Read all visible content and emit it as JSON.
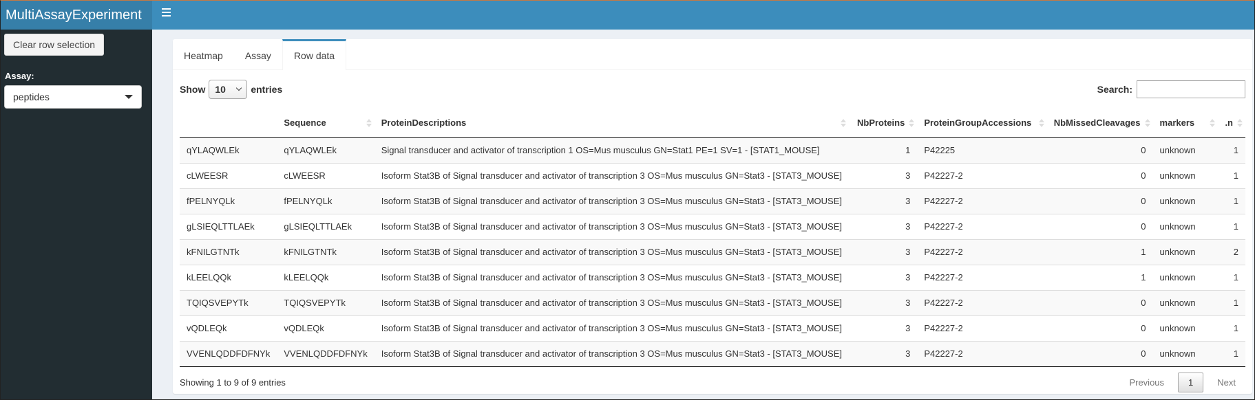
{
  "app": {
    "title": "MultiAssayExperiment"
  },
  "sidebar": {
    "clear_button": "Clear row selection",
    "assay_label": "Assay:",
    "assay_selected": "peptides"
  },
  "tabs": [
    {
      "label": "Heatmap",
      "active": false
    },
    {
      "label": "Assay",
      "active": false
    },
    {
      "label": "Row data",
      "active": true
    }
  ],
  "table_controls": {
    "show_label": "Show",
    "entries_label": "entries",
    "page_length": "10",
    "search_label": "Search:",
    "search_value": ""
  },
  "columns": [
    "",
    "Sequence",
    "ProteinDescriptions",
    "NbProteins",
    "ProteinGroupAccessions",
    "NbMissedCleavages",
    "markers",
    ".n"
  ],
  "rows": [
    [
      "qYLAQWLEk",
      "qYLAQWLEk",
      "Signal transducer and activator of transcription 1 OS=Mus musculus GN=Stat1 PE=1 SV=1 - [STAT1_MOUSE]",
      "1",
      "P42225",
      "0",
      "unknown",
      "1"
    ],
    [
      "cLWEESR",
      "cLWEESR",
      "Isoform Stat3B of Signal transducer and activator of transcription 3 OS=Mus musculus GN=Stat3 - [STAT3_MOUSE]",
      "3",
      "P42227-2",
      "0",
      "unknown",
      "1"
    ],
    [
      "fPELNYQLk",
      "fPELNYQLk",
      "Isoform Stat3B of Signal transducer and activator of transcription 3 OS=Mus musculus GN=Stat3 - [STAT3_MOUSE]",
      "3",
      "P42227-2",
      "0",
      "unknown",
      "1"
    ],
    [
      "gLSIEQLTTLAEk",
      "gLSIEQLTTLAEk",
      "Isoform Stat3B of Signal transducer and activator of transcription 3 OS=Mus musculus GN=Stat3 - [STAT3_MOUSE]",
      "3",
      "P42227-2",
      "0",
      "unknown",
      "1"
    ],
    [
      "kFNILGTNTk",
      "kFNILGTNTk",
      "Isoform Stat3B of Signal transducer and activator of transcription 3 OS=Mus musculus GN=Stat3 - [STAT3_MOUSE]",
      "3",
      "P42227-2",
      "1",
      "unknown",
      "2"
    ],
    [
      "kLEELQQk",
      "kLEELQQk",
      "Isoform Stat3B of Signal transducer and activator of transcription 3 OS=Mus musculus GN=Stat3 - [STAT3_MOUSE]",
      "3",
      "P42227-2",
      "1",
      "unknown",
      "1"
    ],
    [
      "TQIQSVEPYTk",
      "TQIQSVEPYTk",
      "Isoform Stat3B of Signal transducer and activator of transcription 3 OS=Mus musculus GN=Stat3 - [STAT3_MOUSE]",
      "3",
      "P42227-2",
      "0",
      "unknown",
      "1"
    ],
    [
      "vQDLEQk",
      "vQDLEQk",
      "Isoform Stat3B of Signal transducer and activator of transcription 3 OS=Mus musculus GN=Stat3 - [STAT3_MOUSE]",
      "3",
      "P42227-2",
      "0",
      "unknown",
      "1"
    ],
    [
      "VVENLQDDFDFNYk",
      "VVENLQDDFDFNYk",
      "Isoform Stat3B of Signal transducer and activator of transcription 3 OS=Mus musculus GN=Stat3 - [STAT3_MOUSE]",
      "3",
      "P42227-2",
      "0",
      "unknown",
      "1"
    ]
  ],
  "footer": {
    "info": "Showing 1 to 9 of 9 entries",
    "previous": "Previous",
    "page": "1",
    "next": "Next"
  },
  "colors": {
    "header": "#3c8dbc",
    "logo": "#367fa9",
    "sidebar": "#222d32",
    "content_bg": "#ecf0f5"
  }
}
